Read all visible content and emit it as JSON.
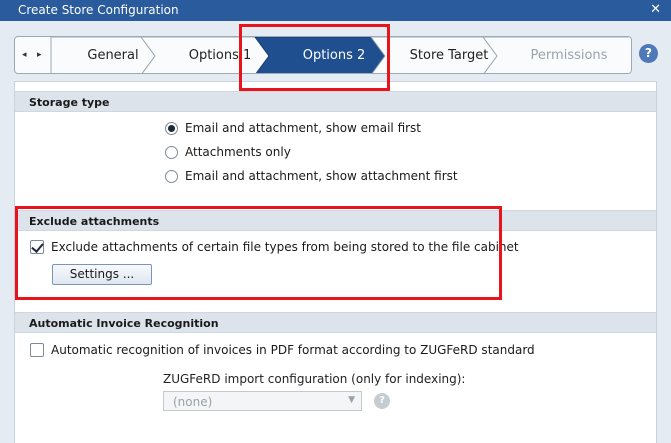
{
  "window": {
    "title": "Create Store Configuration",
    "close": "✕"
  },
  "wizard": {
    "prev_icon": "◂",
    "next_icon": "▸",
    "steps": [
      {
        "label": "General",
        "state": "done"
      },
      {
        "label": "Options 1",
        "state": "done"
      },
      {
        "label": "Options 2",
        "state": "active"
      },
      {
        "label": "Store Target",
        "state": "pending"
      },
      {
        "label": "Permissions",
        "state": "disabled"
      }
    ],
    "help": "?"
  },
  "storage": {
    "header": "Storage type",
    "options": [
      {
        "label": "Email and attachment, show email first",
        "selected": true
      },
      {
        "label": "Attachments only",
        "selected": false
      },
      {
        "label": "Email and attachment, show attachment first",
        "selected": false
      }
    ]
  },
  "exclude": {
    "header": "Exclude attachments",
    "checkbox_label": "Exclude attachments of certain file types from being stored to the file cabinet",
    "checked": true,
    "settings_button": "Settings ..."
  },
  "invoice": {
    "header": "Automatic Invoice Recognition",
    "checkbox_label": "Automatic recognition of invoices in PDF format according to ZUGFeRD standard",
    "checked": false,
    "config_label": "ZUGFeRD import configuration (only for indexing):",
    "dropdown_value": "(none)",
    "help": "?"
  },
  "colors": {
    "titlebar": "#2a5b9c",
    "active_step": "#1f4f8f",
    "highlight": "#e8141c"
  },
  "icons": {
    "close": "close-icon",
    "prev": "prev-arrow-icon",
    "next": "next-arrow-icon",
    "help": "help-icon",
    "dropdown": "chevron-down-icon"
  }
}
